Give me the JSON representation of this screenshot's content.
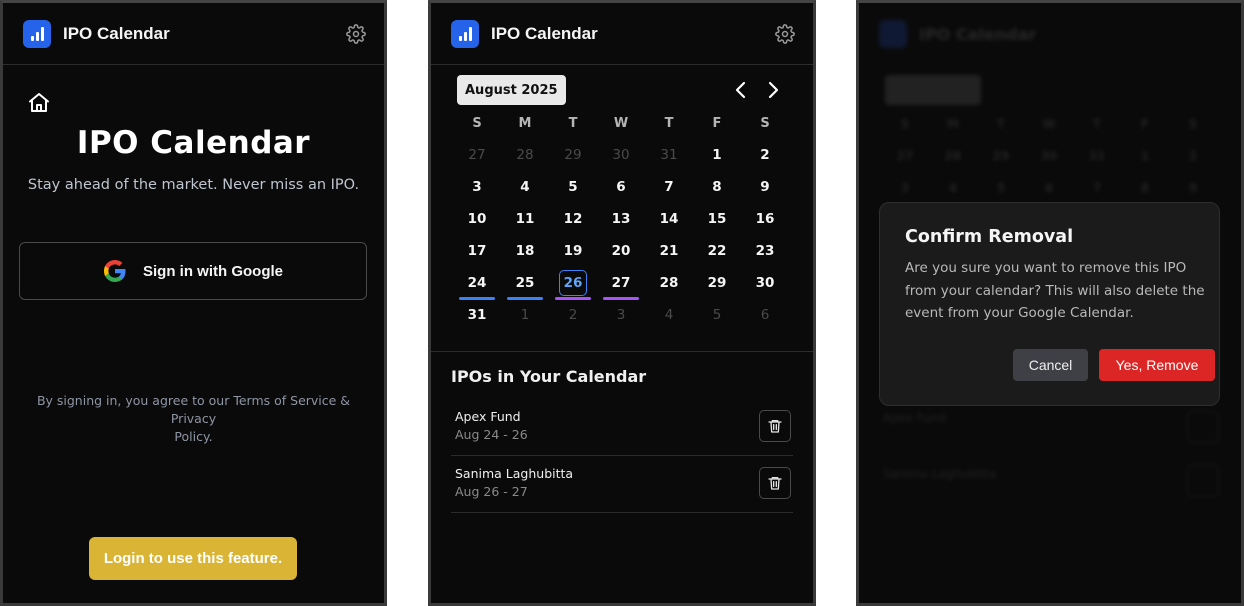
{
  "app": {
    "title": "IPO Calendar"
  },
  "login_screen": {
    "hero_title": "IPO Calendar",
    "hero_subtitle": "Stay ahead of the market. Never miss an IPO.",
    "google_button": "Sign in with Google",
    "terms_line1": "By signing in, you agree to our Terms of Service & Privacy",
    "terms_line2": "Policy.",
    "login_button": "Login to use this feature."
  },
  "calendar_screen": {
    "month_label": "August 2025",
    "weekdays": [
      "S",
      "M",
      "T",
      "W",
      "T",
      "F",
      "S"
    ],
    "weeks": [
      [
        "27",
        "28",
        "29",
        "30",
        "31",
        "1",
        "2"
      ],
      [
        "3",
        "4",
        "5",
        "6",
        "7",
        "8",
        "9"
      ],
      [
        "10",
        "11",
        "12",
        "13",
        "14",
        "15",
        "16"
      ],
      [
        "17",
        "18",
        "19",
        "20",
        "21",
        "22",
        "23"
      ],
      [
        "24",
        "25",
        "26",
        "27",
        "28",
        "29",
        "30"
      ],
      [
        "31",
        "1",
        "2",
        "3",
        "4",
        "5",
        "6"
      ]
    ],
    "muted_cells": [
      "0-0",
      "0-1",
      "0-2",
      "0-3",
      "0-4",
      "5-1",
      "5-2",
      "5-3",
      "5-4",
      "5-5",
      "5-6"
    ],
    "today_cell": "4-2",
    "event_markers": [
      {
        "cell": "4-0",
        "color": "#3b82f6"
      },
      {
        "cell": "4-1",
        "color": "#3b82f6"
      },
      {
        "cell": "4-2",
        "color": "#a855f7"
      },
      {
        "cell": "4-3",
        "color": "#a855f7"
      }
    ],
    "section_title": "IPOs in Your Calendar",
    "ipos": [
      {
        "name": "Apex Fund",
        "dates": "Aug 24 - 26"
      },
      {
        "name": "Sanima Laghubitta",
        "dates": "Aug 26 - 27"
      }
    ]
  },
  "dialog_screen": {
    "title": "Confirm Removal",
    "body_line1": "Are you sure you want to remove this IPO",
    "body_line2": "from your calendar? This will also delete the",
    "body_line3": "event from your Google Calendar.",
    "cancel_label": "Cancel",
    "confirm_label": "Yes, Remove",
    "background_ipos": [
      "Apex Fund",
      "Sanima Laghubitta"
    ]
  },
  "colors": {
    "brand_blue": "#2563eb",
    "login_yellow": "#dab434",
    "danger_red": "#dc2626",
    "marker_blue": "#3b82f6",
    "marker_purple": "#a855f7"
  },
  "icons": [
    "app-logo-icon",
    "gear-icon",
    "home-icon",
    "google-icon",
    "chevron-left-icon",
    "chevron-right-icon",
    "trash-icon"
  ]
}
